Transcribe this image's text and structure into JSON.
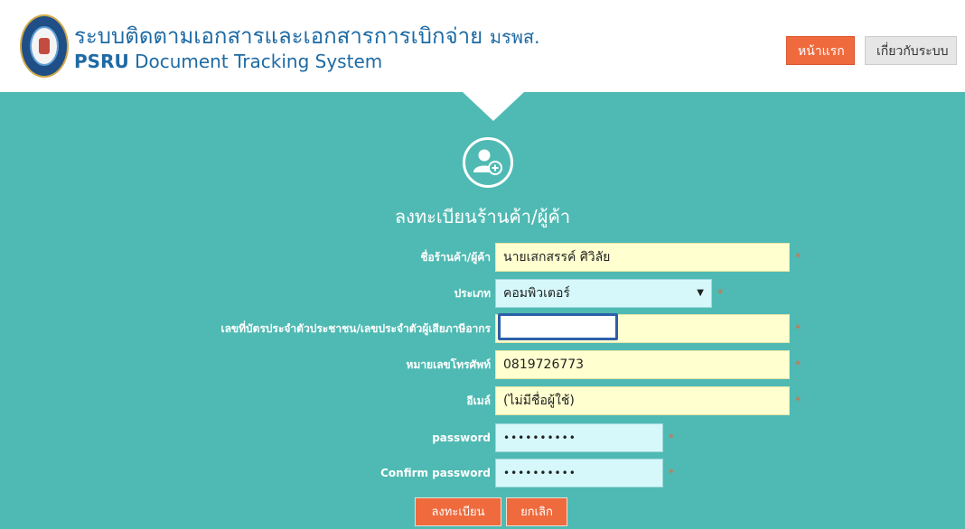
{
  "header": {
    "title_thai": "ระบบติดตามเอกสารและเอกสารการเบิกจ่าย",
    "title_abbr": "มรพส.",
    "subtitle_strong": "PSRU",
    "subtitle_rest": "Document Tracking System",
    "nav": {
      "home": "หน้าแรก",
      "about": "เกี่ยวกับระบบ"
    }
  },
  "page": {
    "heading": "ลงทะเบียนร้านค้า/ผู้ค้า"
  },
  "form": {
    "shop_name_label": "ชื่อร้านค้า/ผู้ค้า",
    "shop_name_value": "นายเสกสรรค์ ศิวิลัย",
    "type_label": "ประเภท",
    "type_value": "คอมพิวเตอร์",
    "id_label": "เลขที่บัตรประจำตัวประชาชน/เลขประจำตัวผู้เสียภาษีอากร",
    "id_value": "",
    "phone_label": "หมายเลขโทรศัพท์",
    "phone_value": "0819726773",
    "email_label": "อีเมล์",
    "email_value": "(ไม่มีชื่อผู้ใช้)",
    "password_label": "password",
    "password_value": "••••••••••",
    "confirm_label": "Confirm password",
    "confirm_value": "••••••••••",
    "required_mark": "*"
  },
  "buttons": {
    "register": "ลงทะเบียน",
    "cancel": "ยกเลิก"
  },
  "colors": {
    "accent": "#ef6a3d",
    "background": "#4fbab3",
    "brand": "#1e6aa4"
  }
}
